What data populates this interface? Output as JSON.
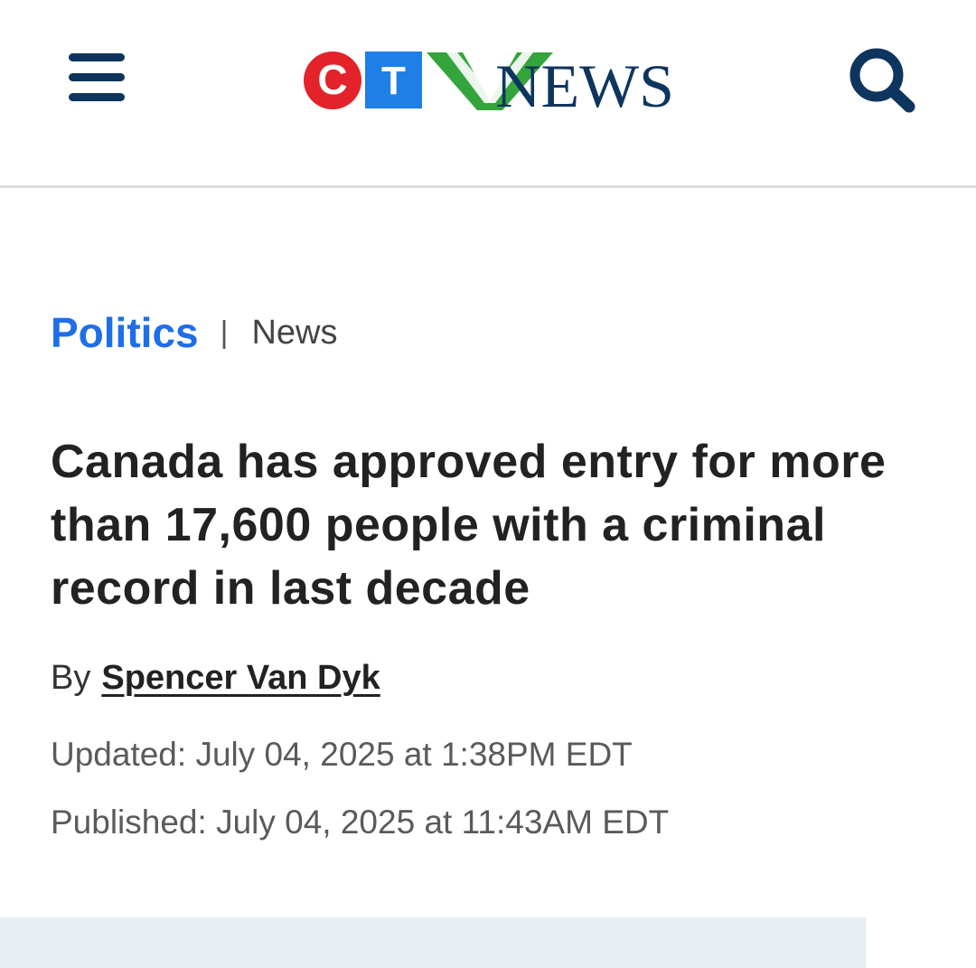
{
  "header": {
    "logo": {
      "c_letter": "C",
      "t_letter": "T",
      "v_letter": "V",
      "wordmark": "NEWS",
      "colors": {
        "red": "#e3222a",
        "blue": "#1e7fe6",
        "green": "#34a43c",
        "navy": "#0e355e"
      }
    },
    "menu_icon": "hamburger-menu-icon",
    "search_icon": "search-icon"
  },
  "article": {
    "category": "Politics",
    "separator": "|",
    "section": "News",
    "headline": "Canada has approved entry for more than 17,600 people with a criminal record in last decade",
    "byline_prefix": "By",
    "author": "Spencer Van Dyk",
    "updated": "Updated: July 04, 2025 at 1:38PM EDT",
    "published": "Published: July 04, 2025 at 11:43AM EDT"
  },
  "colors": {
    "link_blue": "#1e6ee8",
    "headline": "#222222",
    "meta_gray": "#5a5a5a",
    "placeholder_bg": "#e8ecf3"
  }
}
